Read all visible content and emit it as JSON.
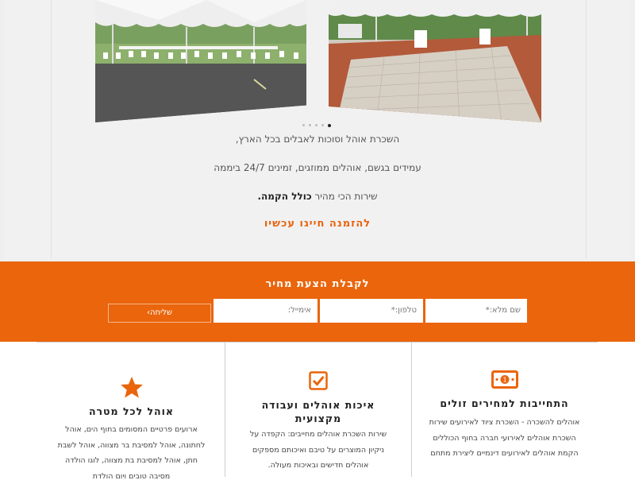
{
  "hero": {
    "slides_count": 5,
    "active_slide": 5,
    "line1": "השכרת אוהל וסוכות לאבלים בכל הארץ,",
    "line2": "עמידים בגשם, אוהלים ממוזגים, זמינים 24/7 ביממה",
    "line3_prefix": "שירות הכי מהיר ",
    "line3_bold": "כולל הקמה.",
    "cta_label": "להזמנה חייגו עכשיו"
  },
  "quote_form": {
    "title": "לקבלת הצעת מחיר",
    "name_placeholder": "שם מלא:*",
    "phone_placeholder": "טלפון:*",
    "email_placeholder": "אימייל:",
    "send_label": "שליחה"
  },
  "features": [
    {
      "icon": "money-icon",
      "title": "התחייבות למחירים זולים",
      "text": "אוהלים להשכרה - השכרת ציוד לאירועים שירות השכרת אוהלים לאירועי חברה בחוף הכוללים הקמת אוהלים לאירועים דינמיים ליצירת מתחם"
    },
    {
      "icon": "checkbox-icon",
      "title": "איכות אוהלים ועבודה מקצועית",
      "text": "שירות השכרת אוהלים מחייבים: הקפדה על ניקיון המוצרים על טיבם ואיכותם מספקים אוהלים חדישים ובאיכות מעולה."
    },
    {
      "icon": "star-icon",
      "title": "אוהל לכל מטרה",
      "text": "ארועים פרטיים המסומים בחוף הים, אוהל לחתונה, אוהל למסיבת בר מצווה, אוהל לשבת חתן, אוהל למסיבת בת מצווה, לוגו הולדה מסיבה טובים ויום הולדת"
    }
  ],
  "colors": {
    "accent": "#ea650c",
    "panel": "#f1f1f1"
  }
}
